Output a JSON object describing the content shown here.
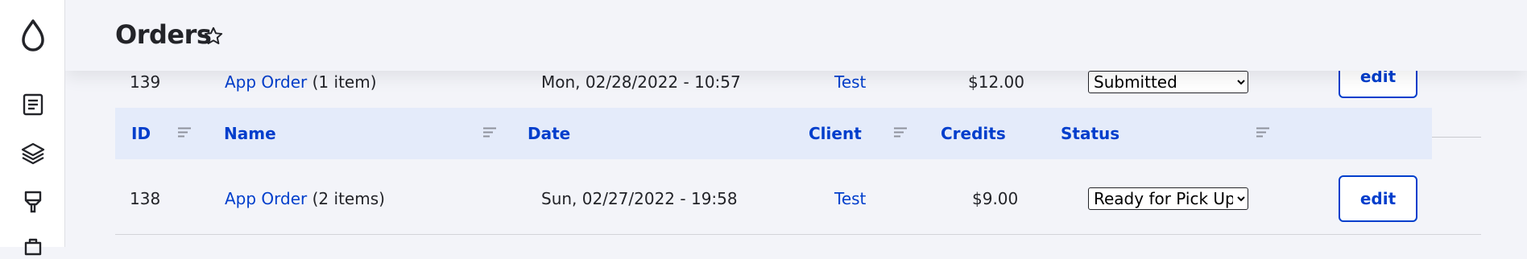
{
  "page": {
    "title": "Orders"
  },
  "table": {
    "columns": [
      "ID",
      "Name",
      "Date",
      "Client",
      "Credits",
      "Status"
    ],
    "rows": [
      {
        "id": "139",
        "name_link": "App Order",
        "name_suffix": " (1 item)",
        "date": "Mon, 02/28/2022 - 10:57",
        "client": "Test",
        "credits": "$12.00",
        "status": "Submitted",
        "action": "edit"
      },
      {
        "id": "138",
        "name_link": "App Order",
        "name_suffix": " (2 items)",
        "date": "Sun, 02/27/2022 - 19:58",
        "client": "Test",
        "credits": "$9.00",
        "status": "Ready for Pick Up",
        "action": "edit"
      }
    ]
  },
  "colors": {
    "link": "#003ecc",
    "header_bg": "#e4ebfa",
    "page_bg": "#f3f4f9"
  },
  "icons": [
    "drupal-drop-icon",
    "content-icon",
    "structure-icon",
    "appearance-icon",
    "extend-icon",
    "star-icon",
    "sort-icon"
  ]
}
